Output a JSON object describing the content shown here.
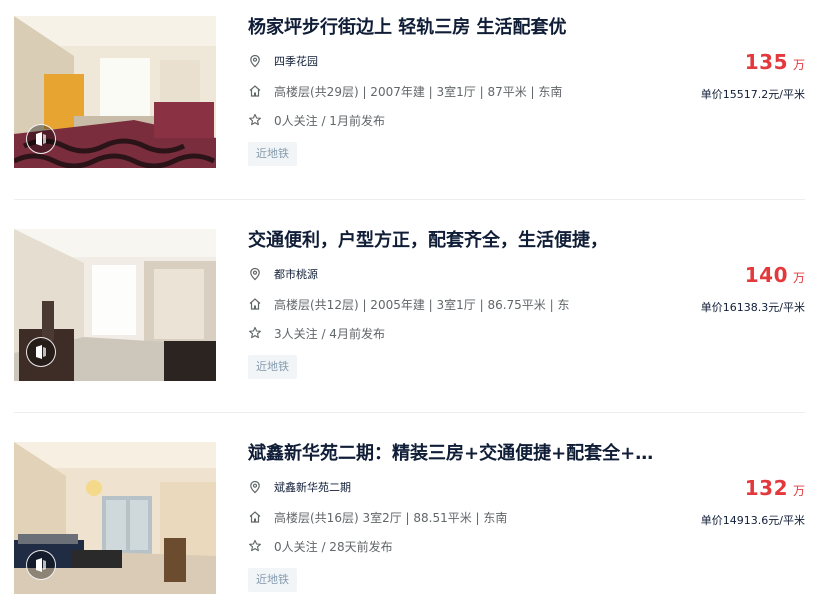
{
  "listings": [
    {
      "title": "杨家坪步行街边上 轻轨三房 生活配套优",
      "community": "四季花园",
      "house_info": "高楼层(共29层) | 2007年建 | 3室1厅 | 87平米 | 东南",
      "follow_info": "0人关注 / 1月前发布",
      "tag": "近地铁",
      "price": "135",
      "price_unit": "万",
      "unit_price": "单价15517.2元/平米"
    },
    {
      "title": "交通便利，户型方正，配套齐全，生活便捷，",
      "community": "都市桃源",
      "house_info": "高楼层(共12层) | 2005年建 | 3室1厅 | 86.75平米 | 东",
      "follow_info": "3人关注 / 4月前发布",
      "tag": "近地铁",
      "price": "140",
      "price_unit": "万",
      "unit_price": "单价16138.3元/平米"
    },
    {
      "title": "斌鑫新华苑二期：精装三房+交通便捷+配套全+…",
      "community": "斌鑫新华苑二期",
      "house_info": "高楼层(共16层) 3室2厅 | 88.51平米 | 东南",
      "follow_info": "0人关注 / 28天前发布",
      "tag": "近地铁",
      "price": "132",
      "price_unit": "万",
      "unit_price": "单价14913.6元/平米"
    }
  ],
  "icons": {
    "location": "map-pin-icon",
    "house": "house-icon",
    "follow": "star-icon",
    "vr": "vr-3d-icon"
  },
  "colors": {
    "price": "#e4393c",
    "title": "#101d37",
    "meta": "#616669",
    "tag_bg": "#f2f5f7",
    "tag_text": "#849aae"
  }
}
